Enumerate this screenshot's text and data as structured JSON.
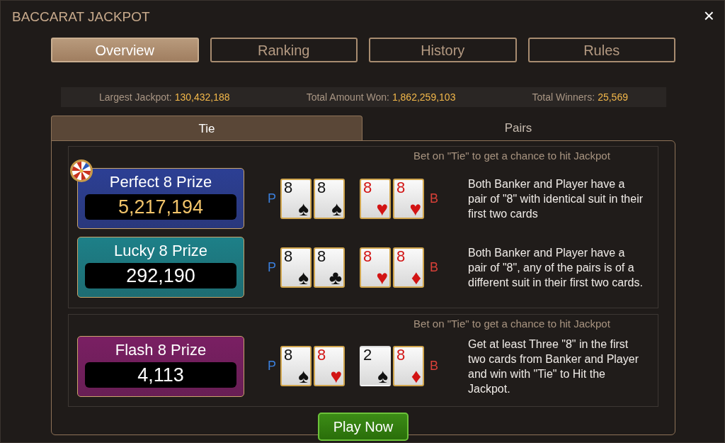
{
  "window": {
    "title": "BACCARAT JACKPOT",
    "close": "×"
  },
  "tabs": [
    {
      "label": "Overview",
      "selected": true
    },
    {
      "label": "Ranking",
      "selected": false
    },
    {
      "label": "History",
      "selected": false
    },
    {
      "label": "Rules",
      "selected": false
    }
  ],
  "stats": [
    {
      "label": "Largest Jackpot:",
      "value": "130,432,188"
    },
    {
      "label": "Total Amount Won:",
      "value": "1,862,259,103"
    },
    {
      "label": "Total Winners:",
      "value": "25,569"
    }
  ],
  "subtabs": [
    {
      "label": "Tie",
      "selected": true
    },
    {
      "label": "Pairs",
      "selected": false
    }
  ],
  "sections": [
    {
      "heading": "Bet on \"Tie\" to get a chance to hit Jackpot",
      "prizes": [
        {
          "name": "Perfect 8 Prize",
          "amount": "5,217,194",
          "color": "#2c3f94",
          "wheel": true,
          "amount_gold": true,
          "player_mark": "P",
          "banker_mark": "B",
          "cards": [
            {
              "rank": "8",
              "suit": "♠",
              "highlighted": true
            },
            {
              "rank": "8",
              "suit": "♠",
              "highlighted": true
            },
            {
              "rank": "8",
              "suit": "♥",
              "highlighted": true
            },
            {
              "rank": "8",
              "suit": "♥",
              "highlighted": true
            }
          ],
          "description": "Both Banker and Player have a pair of \"8\" with identical suit in their first two cards"
        },
        {
          "name": "Lucky 8 Prize",
          "amount": "292,190",
          "color": "#1d8088",
          "wheel": false,
          "amount_gold": false,
          "player_mark": "P",
          "banker_mark": "B",
          "cards": [
            {
              "rank": "8",
              "suit": "♠",
              "highlighted": true
            },
            {
              "rank": "8",
              "suit": "♣",
              "highlighted": true
            },
            {
              "rank": "8",
              "suit": "♥",
              "highlighted": true
            },
            {
              "rank": "8",
              "suit": "♦",
              "highlighted": true
            }
          ],
          "description": "Both Banker and Player have a pair of \"8\", any of the pairs is of a different suit in their first two cards."
        }
      ]
    },
    {
      "heading": "Bet on \"Tie\" to get a chance to hit Jackpot",
      "prizes": [
        {
          "name": "Flash 8 Prize",
          "amount": "4,113",
          "color": "#7a1f63",
          "wheel": false,
          "amount_gold": false,
          "player_mark": "P",
          "banker_mark": "B",
          "cards": [
            {
              "rank": "8",
              "suit": "♠",
              "highlighted": true
            },
            {
              "rank": "8",
              "suit": "♥",
              "highlighted": true
            },
            {
              "rank": "2",
              "suit": "♠",
              "highlighted": false
            },
            {
              "rank": "8",
              "suit": "♦",
              "highlighted": true
            }
          ],
          "description": "Get at least Three \"8\" in the first two cards from Banker and Player and win with \"Tie\" to Hit the Jackpot."
        }
      ]
    }
  ],
  "play_button": "Play Now"
}
